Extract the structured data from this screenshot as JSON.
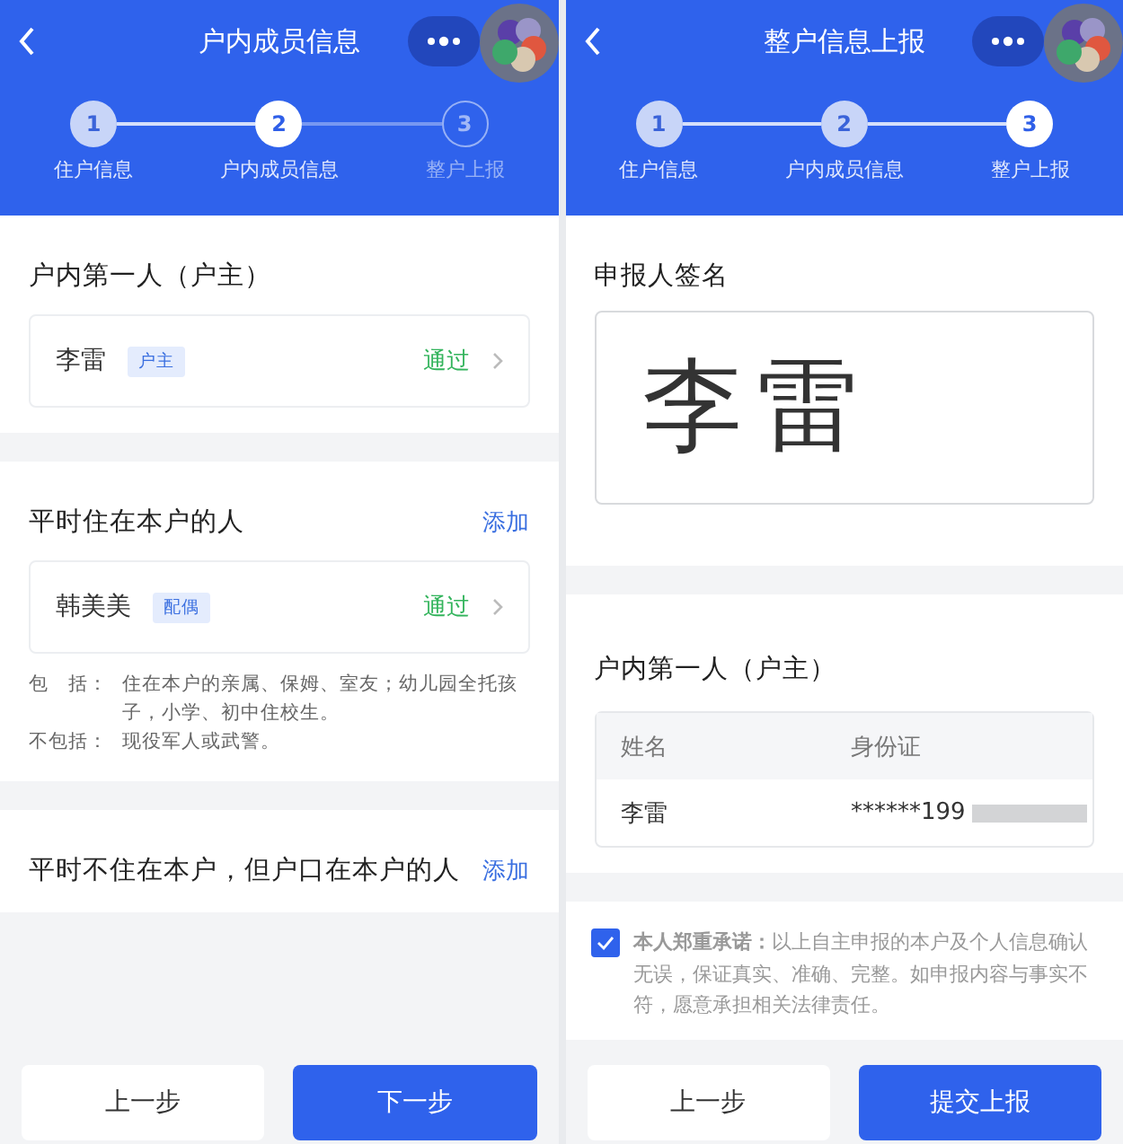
{
  "left_screen": {
    "title": "户内成员信息",
    "steps": [
      {
        "number": "1",
        "label": "住户信息",
        "done": true,
        "selected": false
      },
      {
        "number": "2",
        "label": "户内成员信息",
        "done": false,
        "selected": true
      },
      {
        "number": "3",
        "label": "整户上报",
        "done": false,
        "selected": false
      }
    ],
    "sections": [
      {
        "title": "户内第一人（户主）",
        "members": [
          {
            "name": "李雷",
            "tag": "户主",
            "status": "通过"
          }
        ]
      },
      {
        "title": "平时住在本户的人",
        "action": "添加",
        "members": [
          {
            "name": "韩美美",
            "tag": "配偶",
            "status": "通过"
          }
        ],
        "notes": [
          {
            "label": "包　括：",
            "text": "住在本户的亲属、保姆、室友；幼儿园全托孩子，小学、初中住校生。"
          },
          {
            "label": "不包括：",
            "text": "现役军人或武警。"
          }
        ]
      },
      {
        "title": "平时不住在本户，但户口在本户的人",
        "action": "添加"
      }
    ],
    "buttons": [
      {
        "label": "上一步",
        "primary": false
      },
      {
        "label": "下一步",
        "primary": true
      }
    ]
  },
  "right_screen": {
    "title": "整户信息上报",
    "steps": [
      {
        "number": "1",
        "label": "住户信息",
        "done": true,
        "selected": false
      },
      {
        "number": "2",
        "label": "户内成员信息",
        "done": true,
        "selected": false
      },
      {
        "number": "3",
        "label": "整户上报",
        "done": false,
        "selected": true
      }
    ],
    "signature": {
      "title": "申报人签名",
      "value": "李雷"
    },
    "head": {
      "title": "户内第一人（户主）",
      "columns": [
        "姓名",
        "身份证"
      ],
      "rows": [
        [
          "李雷",
          "******199"
        ]
      ]
    },
    "consent": {
      "checked": true,
      "text": "**本人郑重承诺：**以上自主申报的本户及个人信息确认无误，保证真实、准确、完整。如申报内容与事实不符，愿意承担相关法律责任。"
    },
    "buttons": [
      {
        "label": "上一步",
        "primary": false
      },
      {
        "label": "提交上报",
        "primary": true
      }
    ]
  }
}
